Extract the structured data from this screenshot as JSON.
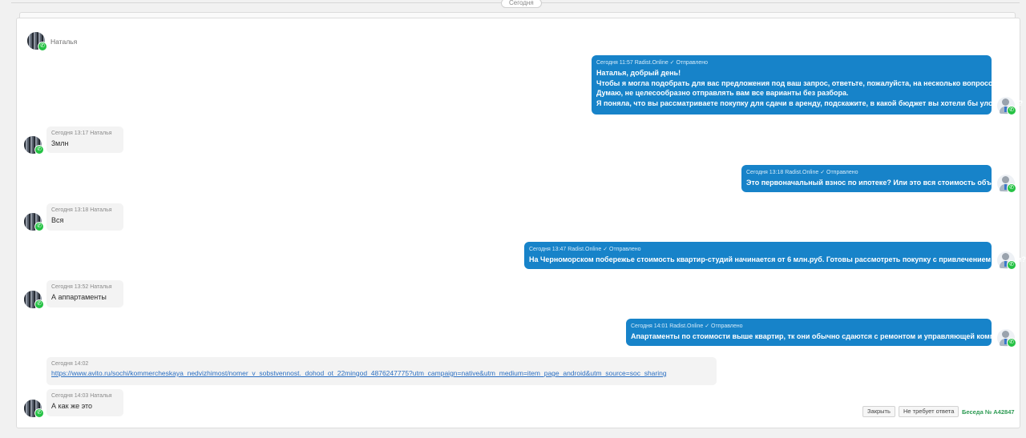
{
  "divider": {
    "date_label": "Сегодня"
  },
  "contact": {
    "name": "Наталья"
  },
  "messages": [
    {
      "id": "m1",
      "direction": "out",
      "meta": "Сегодня 11:57 Radist.Online ✓ Отправлено",
      "lines": [
        "Наталья, добрый день!",
        "Чтобы я могла подобрать для вас предложения под ваш запрос, ответьте, пожалуйста, на несколько вопросов.",
        "Думаю, не целесообразно отправлять вам все варианты без разбора.",
        "Я поняла, что вы рассматриваете покупку для сдачи в аренду, подскажите, в какой бюджет вы хотели бы уложиться?"
      ]
    },
    {
      "id": "m2",
      "direction": "in",
      "meta": "Сегодня 13:17 Наталья",
      "lines": [
        "3млн"
      ]
    },
    {
      "id": "m3",
      "direction": "out",
      "meta": "Сегодня 13:18 Radist.Online ✓ Отправлено",
      "lines": [
        "Это первоначальный взнос по ипотеке? Или это вся стоимость объекта?"
      ]
    },
    {
      "id": "m4",
      "direction": "in",
      "meta": "Сегодня 13:18 Наталья",
      "lines": [
        "Вся"
      ]
    },
    {
      "id": "m5",
      "direction": "out",
      "meta": "Сегодня 13:47 Radist.Online ✓ Отправлено",
      "lines": [
        "На Черноморском побережье стоимость квартир-студий начинается от 6 млн.руб. Готовы рассмотреть покупку с привлечением ипотеки?"
      ]
    },
    {
      "id": "m6",
      "direction": "in",
      "meta": "Сегодня 13:52 Наталья",
      "lines": [
        "А аппартаменты"
      ]
    },
    {
      "id": "m7",
      "direction": "out",
      "meta": "Сегодня 14:01 Radist.Online ✓ Отправлено",
      "lines": [
        "Апартаменты по стоимости выше квартир, тк они обычно сдаются с ремонтом и управляющей компанией."
      ]
    },
    {
      "id": "m8",
      "direction": "in",
      "meta": "Сегодня 14:02",
      "link": "https://www.avito.ru/sochi/kommercheskaya_nedvizhimost/nomer_v_sobstvennost._dohod_ot_22mingod_4876247775?utm_campaign=native&utm_medium=item_page_android&utm_source=soc_sharing"
    },
    {
      "id": "m9",
      "direction": "in",
      "meta": "Сегодня 14:03 Наталья",
      "lines": [
        "А как же это"
      ]
    }
  ],
  "footer": {
    "close_label": "Закрыть",
    "no_reply_label": "Не требует ответа",
    "conversation_label": "Беседа № A42847"
  },
  "icons": {
    "channel": "whatsapp-icon",
    "agent": "agent-avatar-icon"
  },
  "colors": {
    "outgoing_bubble": "#1783c9",
    "incoming_bubble": "#f3f3f3",
    "whatsapp": "#25c244",
    "conversation_number": "#2e9b54"
  }
}
